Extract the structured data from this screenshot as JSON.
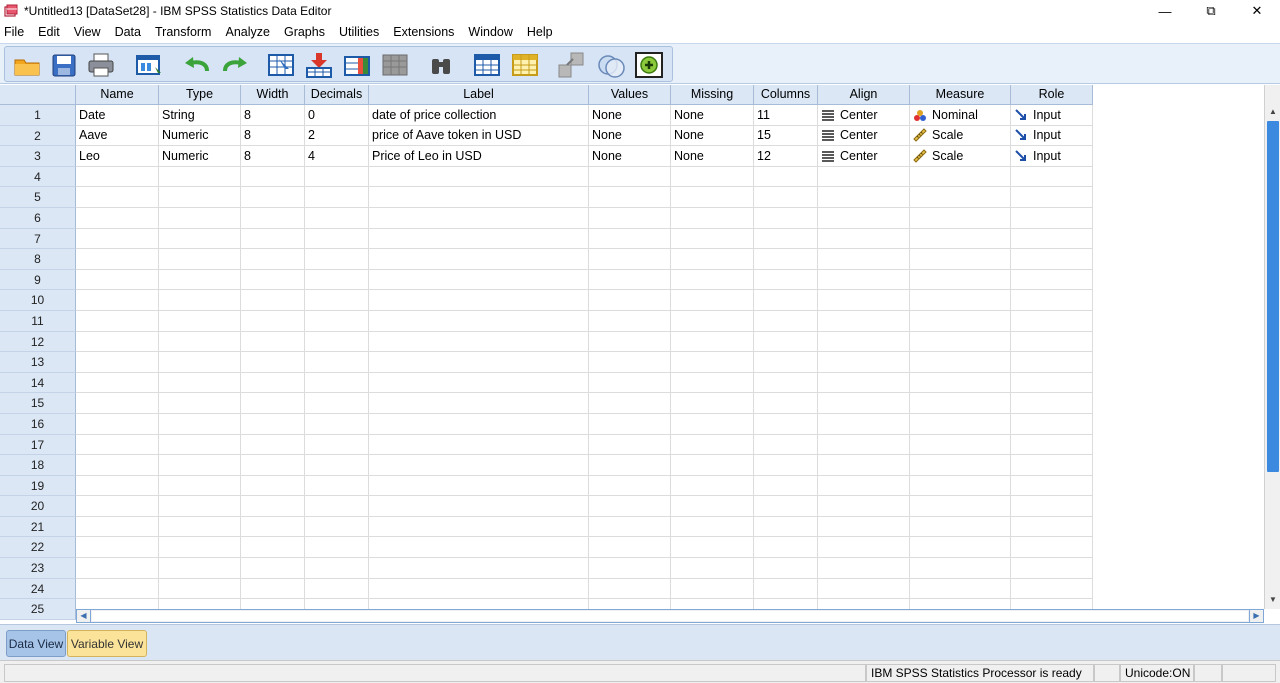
{
  "window": {
    "title": "*Untitled13 [DataSet28] - IBM SPSS Statistics Data Editor",
    "minimize": "—",
    "restore": "⧉",
    "close": "✕"
  },
  "menu": [
    {
      "label": "File"
    },
    {
      "label": "Edit"
    },
    {
      "label": "View"
    },
    {
      "label": "Data"
    },
    {
      "label": "Transform"
    },
    {
      "label": "Analyze"
    },
    {
      "label": "Graphs"
    },
    {
      "label": "Utilities"
    },
    {
      "label": "Extensions"
    },
    {
      "label": "Window"
    },
    {
      "label": "Help"
    }
  ],
  "toolbar": {
    "icons": [
      "open-folder-icon",
      "save-icon",
      "print-icon",
      "dialog-recall-icon",
      "undo-icon",
      "redo-icon",
      "goto-case-icon",
      "goto-variable-icon",
      "variables-icon",
      "find-icon",
      "insert-cases-icon",
      "insert-variable-icon",
      "split-file-icon",
      "weight-cases-icon",
      "select-cases-icon",
      "value-labels-icon",
      "use-variable-sets-icon"
    ]
  },
  "grid": {
    "columns": [
      "Name",
      "Type",
      "Width",
      "Decimals",
      "Label",
      "Values",
      "Missing",
      "Columns",
      "Align",
      "Measure",
      "Role"
    ],
    "rows": [
      {
        "num": "1",
        "name": "Date",
        "type": "String",
        "width": "8",
        "decimals": "0",
        "label": "date of price collection",
        "values": "None",
        "missing": "None",
        "columns": "11",
        "align": "Center",
        "measure": "Nominal",
        "measure_icon": "nominal-icon",
        "role": "Input"
      },
      {
        "num": "2",
        "name": "Aave",
        "type": "Numeric",
        "width": "8",
        "decimals": "2",
        "label": "price of Aave token in USD",
        "values": "None",
        "missing": "None",
        "columns": "15",
        "align": "Center",
        "measure": "Scale",
        "measure_icon": "scale-ruler-icon",
        "role": "Input"
      },
      {
        "num": "3",
        "name": "Leo",
        "type": "Numeric",
        "width": "8",
        "decimals": "4",
        "label": "Price of Leo in USD",
        "values": "None",
        "missing": "None",
        "columns": "12",
        "align": "Center",
        "measure": "Scale",
        "measure_icon": "scale-ruler-icon",
        "role": "Input"
      }
    ],
    "empty_row_numbers": [
      "4",
      "5",
      "6",
      "7",
      "8",
      "9",
      "10",
      "11",
      "12",
      "13",
      "14",
      "15",
      "16",
      "17",
      "18",
      "19",
      "20",
      "21",
      "22",
      "23",
      "24",
      "25"
    ]
  },
  "tabs": {
    "data_view": "Data View",
    "variable_view": "Variable View",
    "active": "Variable View"
  },
  "status": {
    "processor": "IBM SPSS Statistics Processor is ready",
    "unicode": "Unicode:ON"
  },
  "colors": {
    "header_bg": "#dbe7f5",
    "active_tab": "#fbe39a",
    "scroll_thumb": "#3c8ae0"
  }
}
